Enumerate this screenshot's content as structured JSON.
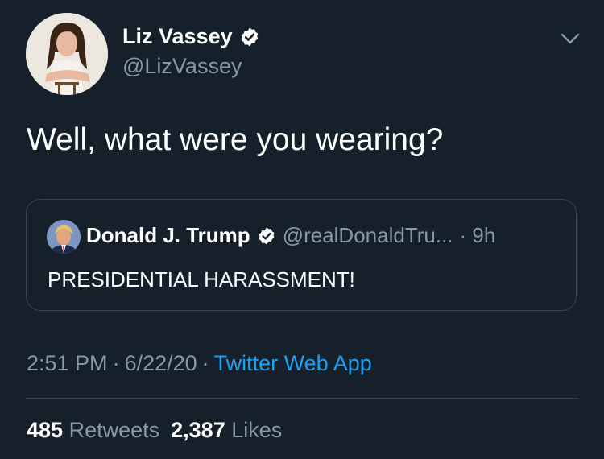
{
  "tweet": {
    "author": {
      "name": "Liz Vassey",
      "handle": "@LizVassey"
    },
    "text": "Well, what were you wearing?",
    "quoted": {
      "name": "Donald J. Trump",
      "handle": "@realDonaldTru...",
      "time": "· 9h",
      "text": "PRESIDENTIAL HARASSMENT!"
    },
    "time": "2:51 PM",
    "date": "6/22/20",
    "separator": "·",
    "source": "Twitter Web App",
    "retweets": {
      "count": "485",
      "label": "Retweets"
    },
    "likes": {
      "count": "2,387",
      "label": "Likes"
    }
  },
  "colors": {
    "background": "#15202b",
    "primary_text": "#ffffff",
    "secondary_text": "#8899a6",
    "accent": "#1da1f2",
    "border": "#38444d"
  },
  "icons": {
    "verified": "verified-badge-icon",
    "caret": "chevron-down-icon"
  }
}
